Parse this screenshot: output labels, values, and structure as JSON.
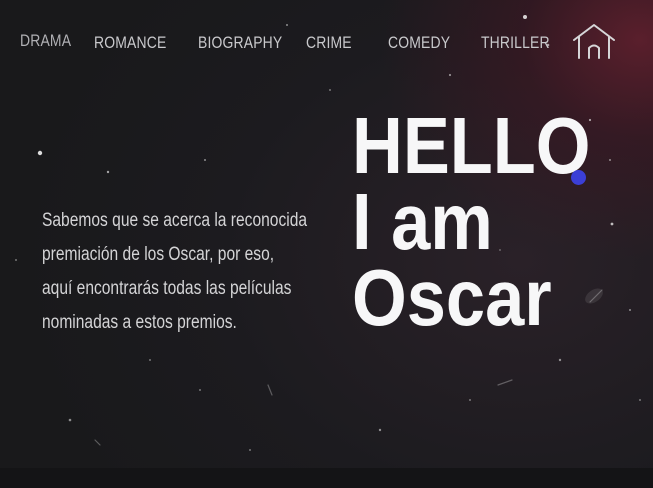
{
  "nav": {
    "items": [
      {
        "label": "DRAMA"
      },
      {
        "label": "ROMANCE"
      },
      {
        "label": "BIOGRAPHY"
      },
      {
        "label": "CRIME"
      },
      {
        "label": "COMEDY"
      },
      {
        "label": "THRILLER"
      }
    ],
    "home_icon": "home-icon"
  },
  "intro": {
    "line1": "Sabemos que se acerca la reconocida",
    "line2": "premiación de los Oscar, por eso,",
    "line3": "aquí encontrarás todas las películas",
    "line4": "nominadas a estos premios."
  },
  "hero": {
    "line1": "HELLO",
    "line2": "I am",
    "line3": "Oscar"
  },
  "colors": {
    "accent_dot": "#3b3fd6",
    "background": "#1c1b1f",
    "glow": "#5a1f2c"
  }
}
